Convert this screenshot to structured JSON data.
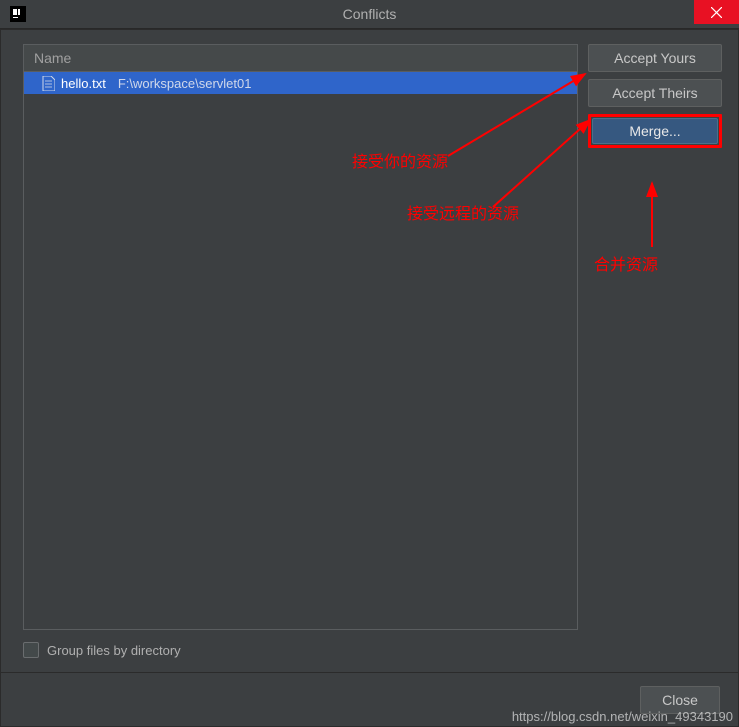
{
  "titlebar": {
    "title": "Conflicts"
  },
  "list": {
    "header": "Name",
    "rows": [
      {
        "filename": "hello.txt",
        "path": "F:\\workspace\\servlet01"
      }
    ]
  },
  "buttons": {
    "accept_yours": "Accept Yours",
    "accept_theirs": "Accept Theirs",
    "merge": "Merge..."
  },
  "group_checkbox": {
    "label": "Group files by directory",
    "checked": false
  },
  "footer": {
    "close": "Close"
  },
  "annotations": {
    "accept_yours": "接受你的资源",
    "accept_theirs": "接受远程的资源",
    "merge": "合并资源"
  },
  "watermark": "https://blog.csdn.net/weixin_49343190"
}
